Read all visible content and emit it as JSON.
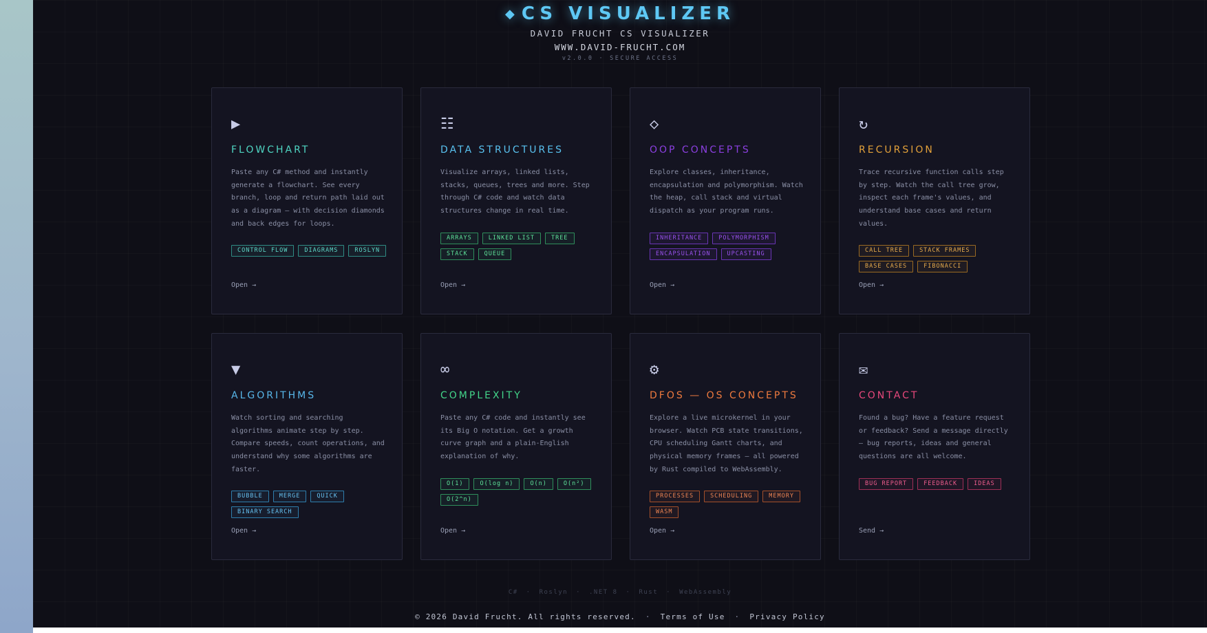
{
  "header": {
    "diamond_glyph": "◆",
    "title": "CS VISUALIZER",
    "subtitle": "DAVID FRUCHT CS VISUALIZER",
    "url": "WWW.DAVID-FRUCHT.COM",
    "version": "v2.0.0",
    "separator": "·",
    "access": "SECURE ACCESS"
  },
  "cards": [
    {
      "icon_name": "play-icon",
      "icon": "▶",
      "title": "FLOWCHART",
      "color": "#4fd6c3",
      "description": "Paste any C# method and instantly generate a flowchart. See every branch, loop and return path laid out as a diagram — with decision diamonds and back edges for loops.",
      "tags": [
        "CONTROL FLOW",
        "DIAGRAMS",
        "ROSLYN"
      ],
      "action": "Open →"
    },
    {
      "icon_name": "list-icon",
      "icon": "☷",
      "title": "DATA STRUCTURES",
      "color": "#59c2f0",
      "description": "Visualize arrays, linked lists, stacks, queues, trees and more. Step through C# code and watch data structures change in real time.",
      "tags": [
        "ARRAYS",
        "LINKED LIST",
        "TREE",
        "STACK",
        "QUEUE"
      ],
      "action": "Open →"
    },
    {
      "icon_name": "diamond-outline-icon",
      "icon": "◇",
      "title": "OOP CONCEPTS",
      "color": "#8b3fe0",
      "description": "Explore classes, inheritance, encapsulation and polymorphism. Watch the heap, call stack and virtual dispatch as your program runs.",
      "tags": [
        "INHERITANCE",
        "POLYMORPHISM",
        "ENCAPSULATION",
        "UPCASTING"
      ],
      "action": "Open →"
    },
    {
      "icon_name": "refresh-icon",
      "icon": "↻",
      "title": "RECURSION",
      "color": "#e3a13a",
      "description": "Trace recursive function calls step by step. Watch the call tree grow, inspect each frame's values, and understand base cases and return values.",
      "tags": [
        "CALL TREE",
        "STACK FRAMES",
        "BASE CASES",
        "FIBONACCI"
      ],
      "action": "Open →"
    },
    {
      "icon_name": "triangle-down-icon",
      "icon": "▼",
      "title": "ALGORITHMS",
      "color": "#58b7ea",
      "description": "Watch sorting and searching algorithms animate step by step. Compare speeds, count operations, and understand why some algorithms are faster.",
      "tags": [
        "BUBBLE",
        "MERGE",
        "QUICK",
        "BINARY SEARCH"
      ],
      "action": "Open →"
    },
    {
      "icon_name": "infinity-icon",
      "icon": "∞",
      "title": "COMPLEXITY",
      "color": "#43d68a",
      "description": "Paste any C# code and instantly see its Big O notation. Get a growth curve graph and a plain-English explanation of why.",
      "tags": [
        "O(1)",
        "O(log n)",
        "O(n)",
        "O(n²)",
        "O(2^n)"
      ],
      "action": "Open →"
    },
    {
      "icon_name": "gear-icon",
      "icon": "⚙",
      "title": "DFOS — OS CONCEPTS",
      "color": "#ee7a3e",
      "description": "Explore a live microkernel in your browser. Watch PCB state transitions, CPU scheduling Gantt charts, and physical memory frames — all powered by Rust compiled to WebAssembly.",
      "tags": [
        "PROCESSES",
        "SCHEDULING",
        "MEMORY",
        "WASM"
      ],
      "action": "Open →"
    },
    {
      "icon_name": "envelope-icon",
      "icon": "✉",
      "title": "CONTACT",
      "color": "#e8487c",
      "description": "Found a bug? Have a feature request or feedback? Send a message directly — bug reports, ideas and general questions are all welcome.",
      "tags": [
        "BUG REPORT",
        "FEEDBACK",
        "IDEAS"
      ],
      "action": "Send →"
    }
  ],
  "tech": [
    "C#",
    "Roslyn",
    ".NET 8",
    "Rust",
    "WebAssembly"
  ],
  "footer": {
    "copyright": "© 2026 David Frucht. All rights reserved.",
    "separator": "·",
    "terms": "Terms of Use",
    "privacy": "Privacy Policy"
  }
}
